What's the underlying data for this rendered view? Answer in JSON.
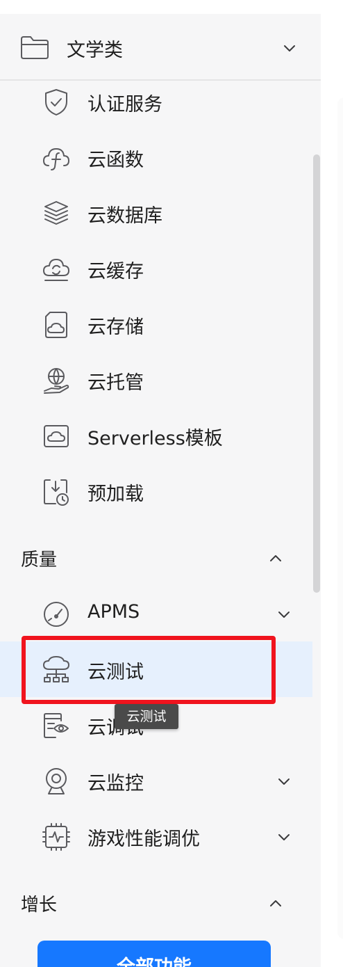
{
  "category": {
    "label": "文学类"
  },
  "items_top": [
    {
      "label": "认证服务",
      "icon": "shield-check-icon"
    },
    {
      "label": "云函数",
      "icon": "cloud-function-icon"
    },
    {
      "label": "云数据库",
      "icon": "database-layers-icon"
    },
    {
      "label": "云缓存",
      "icon": "cloud-sync-icon"
    },
    {
      "label": "云存储",
      "icon": "cloud-storage-icon"
    },
    {
      "label": "云托管",
      "icon": "globe-hand-icon"
    },
    {
      "label": "Serverless模板",
      "icon": "cloud-template-icon"
    },
    {
      "label": "预加载",
      "icon": "preload-clock-icon"
    }
  ],
  "sections": {
    "quality": {
      "label": "质量"
    },
    "growth": {
      "label": "增长"
    }
  },
  "items_quality": [
    {
      "label": "APMS",
      "icon": "gauge-icon",
      "expandable": true
    },
    {
      "label": "云测试",
      "icon": "cloud-network-icon",
      "selected": true
    },
    {
      "label": "云调试",
      "icon": "document-eye-icon"
    },
    {
      "label": "云监控",
      "icon": "webcam-icon",
      "expandable": true
    },
    {
      "label": "游戏性能调优",
      "icon": "chip-pulse-icon",
      "expandable": true
    }
  ],
  "tooltip": {
    "text": "云测试"
  },
  "cta": {
    "label": "全部功能"
  },
  "colors": {
    "accent": "#1678ff",
    "highlight": "#f0141e",
    "selected_bg": "#e6f0fd"
  }
}
